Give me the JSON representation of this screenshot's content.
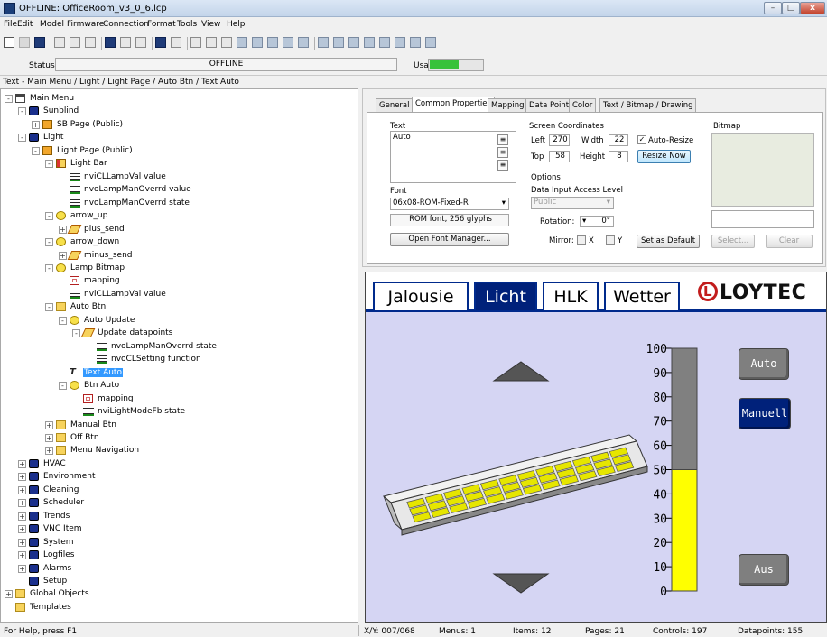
{
  "window": {
    "title": "OFFLINE: OfficeRoom_v3_0_6.lcp",
    "buttons": {
      "minimize": "–",
      "maximize": "□",
      "close": "x"
    }
  },
  "menu": [
    "File",
    "Edit",
    "Model",
    "Firmware",
    "Connection",
    "Format",
    "Tools",
    "View",
    "Help"
  ],
  "status": {
    "label": "Status",
    "value": "OFFLINE",
    "usage_label": "Usage",
    "usage_level": 0.55
  },
  "path": "Text - Main Menu / Light / Light Page / Auto Btn / Text Auto",
  "tree": [
    {
      "label": "Main Menu",
      "icon": "menu-icon",
      "indent": 0,
      "toggle": "-"
    },
    {
      "label": "Sunblind",
      "icon": "submenu-icon",
      "indent": 1,
      "toggle": "-"
    },
    {
      "label": "SB Page (Public)",
      "icon": "page-icon",
      "indent": 2,
      "toggle": "+"
    },
    {
      "label": "Light",
      "icon": "submenu-icon",
      "indent": 1,
      "toggle": "-"
    },
    {
      "label": "Light Page (Public)",
      "icon": "page-icon",
      "indent": 2,
      "toggle": "-"
    },
    {
      "label": "Light Bar",
      "icon": "bar-icon",
      "indent": 3,
      "toggle": "-"
    },
    {
      "label": "nviCLLampVal value",
      "icon": "datapoint-icon",
      "indent": 4,
      "toggle": ""
    },
    {
      "label": "nvoLampManOverrd value",
      "icon": "datapoint-icon",
      "indent": 4,
      "toggle": ""
    },
    {
      "label": "nvoLampManOverrd state",
      "icon": "datapoint-icon",
      "indent": 4,
      "toggle": ""
    },
    {
      "label": "arrow_up",
      "icon": "bulb-icon",
      "indent": 3,
      "toggle": "-"
    },
    {
      "label": "plus_send",
      "icon": "action-icon",
      "indent": 4,
      "toggle": "+"
    },
    {
      "label": "arrow_down",
      "icon": "bulb-icon",
      "indent": 3,
      "toggle": "-"
    },
    {
      "label": "minus_send",
      "icon": "action-icon",
      "indent": 4,
      "toggle": "+"
    },
    {
      "label": "Lamp Bitmap",
      "icon": "bulb-icon",
      "indent": 3,
      "toggle": "-"
    },
    {
      "label": "mapping",
      "icon": "mapping-icon",
      "indent": 4,
      "toggle": ""
    },
    {
      "label": "nviCLLampVal value",
      "icon": "datapoint-icon",
      "indent": 4,
      "toggle": ""
    },
    {
      "label": "Auto Btn",
      "icon": "folder-icon",
      "indent": 3,
      "toggle": "-"
    },
    {
      "label": "Auto Update",
      "icon": "bulb-icon",
      "indent": 4,
      "toggle": "-"
    },
    {
      "label": "Update datapoints",
      "icon": "action-icon",
      "indent": 5,
      "toggle": "-"
    },
    {
      "label": "nvoLampManOverrd state",
      "icon": "datapoint-icon",
      "indent": 6,
      "toggle": ""
    },
    {
      "label": "nvoCLSetting function",
      "icon": "datapoint-icon",
      "indent": 6,
      "toggle": ""
    },
    {
      "label": "Text Auto",
      "icon": "text-icon",
      "indent": 4,
      "toggle": "",
      "selected": true
    },
    {
      "label": "Btn Auto",
      "icon": "bulb-icon",
      "indent": 4,
      "toggle": "-"
    },
    {
      "label": "mapping",
      "icon": "mapping-icon",
      "indent": 5,
      "toggle": ""
    },
    {
      "label": "nviLightModeFb state",
      "icon": "datapoint-icon",
      "indent": 5,
      "toggle": ""
    },
    {
      "label": "Manual Btn",
      "icon": "folder-icon",
      "indent": 3,
      "toggle": "+"
    },
    {
      "label": "Off Btn",
      "icon": "folder-icon",
      "indent": 3,
      "toggle": "+"
    },
    {
      "label": "Menu Navigation",
      "icon": "folder-icon",
      "indent": 3,
      "toggle": "+"
    },
    {
      "label": "HVAC",
      "icon": "submenu-icon",
      "indent": 1,
      "toggle": "+"
    },
    {
      "label": "Environment",
      "icon": "submenu-icon",
      "indent": 1,
      "toggle": "+"
    },
    {
      "label": "Cleaning",
      "icon": "submenu-icon",
      "indent": 1,
      "toggle": "+"
    },
    {
      "label": "Scheduler",
      "icon": "submenu-icon",
      "indent": 1,
      "toggle": "+"
    },
    {
      "label": "Trends",
      "icon": "submenu-icon",
      "indent": 1,
      "toggle": "+"
    },
    {
      "label": "VNC Item",
      "icon": "submenu-icon",
      "indent": 1,
      "toggle": "+"
    },
    {
      "label": "System",
      "icon": "submenu-icon",
      "indent": 1,
      "toggle": "+"
    },
    {
      "label": "Logfiles",
      "icon": "submenu-icon",
      "indent": 1,
      "toggle": "+"
    },
    {
      "label": "Alarms",
      "icon": "submenu-icon",
      "indent": 1,
      "toggle": "+"
    },
    {
      "label": "Setup",
      "icon": "submenu-icon",
      "indent": 1,
      "toggle": ""
    },
    {
      "label": "Global Objects",
      "icon": "folder-icon",
      "indent": 0,
      "toggle": "+"
    },
    {
      "label": "Templates",
      "icon": "folder-icon",
      "indent": 0,
      "toggle": ""
    }
  ],
  "props": {
    "tabs": [
      "General",
      "Common Properties",
      "Mapping",
      "Data Point",
      "Color",
      "Text / Bitmap / Drawing"
    ],
    "active_tab": 1,
    "text_group": "Text",
    "text_value": "Auto",
    "coords_group": "Screen Coordinates",
    "left_label": "Left",
    "left": "270",
    "width_label": "Width",
    "width": "22",
    "top_label": "Top",
    "top": "58",
    "height_label": "Height",
    "height": "8",
    "auto_resize": "Auto-Resize",
    "resize_now": "Resize Now",
    "bitmap_group": "Bitmap",
    "select_btn": "Select...",
    "clear_btn": "Clear",
    "font_group": "Font",
    "font_value": "06x08-ROM-Fixed-R",
    "font_info": "ROM font, 256 glyphs",
    "font_manager": "Open Font Manager...",
    "options_group": "Options",
    "access_label": "Data Input Access Level",
    "access_value": "Public",
    "rotation_label": "Rotation:",
    "rotation_value": "0°",
    "mirror_label": "Mirror:",
    "mirror_x": "X",
    "mirror_y": "Y",
    "set_default": "Set as Default"
  },
  "preview": {
    "tabs": [
      "Jalousie",
      "Licht",
      "HLK",
      "Wetter"
    ],
    "active_tab": 1,
    "logo": "LOYTEC",
    "logo_mark": "L",
    "scale": [
      "100",
      "90",
      "80",
      "70",
      "60",
      "50",
      "40",
      "30",
      "20",
      "10",
      "0"
    ],
    "level": 50,
    "buttons": {
      "auto": "Auto",
      "manual": "Manuell",
      "off": "Aus"
    },
    "colors": {
      "nav": "#00217a",
      "bar_fill": "#ffff00",
      "bar_empty": "#808080",
      "lamp": "#e6e600"
    }
  },
  "statusbar": {
    "help": "For Help, press F1",
    "xy": "X/Y: 007/068",
    "menus": "Menus: 1",
    "items": "Items: 12",
    "pages": "Pages: 21",
    "controls": "Controls: 197",
    "datapoints": "Datapoints: 155"
  }
}
